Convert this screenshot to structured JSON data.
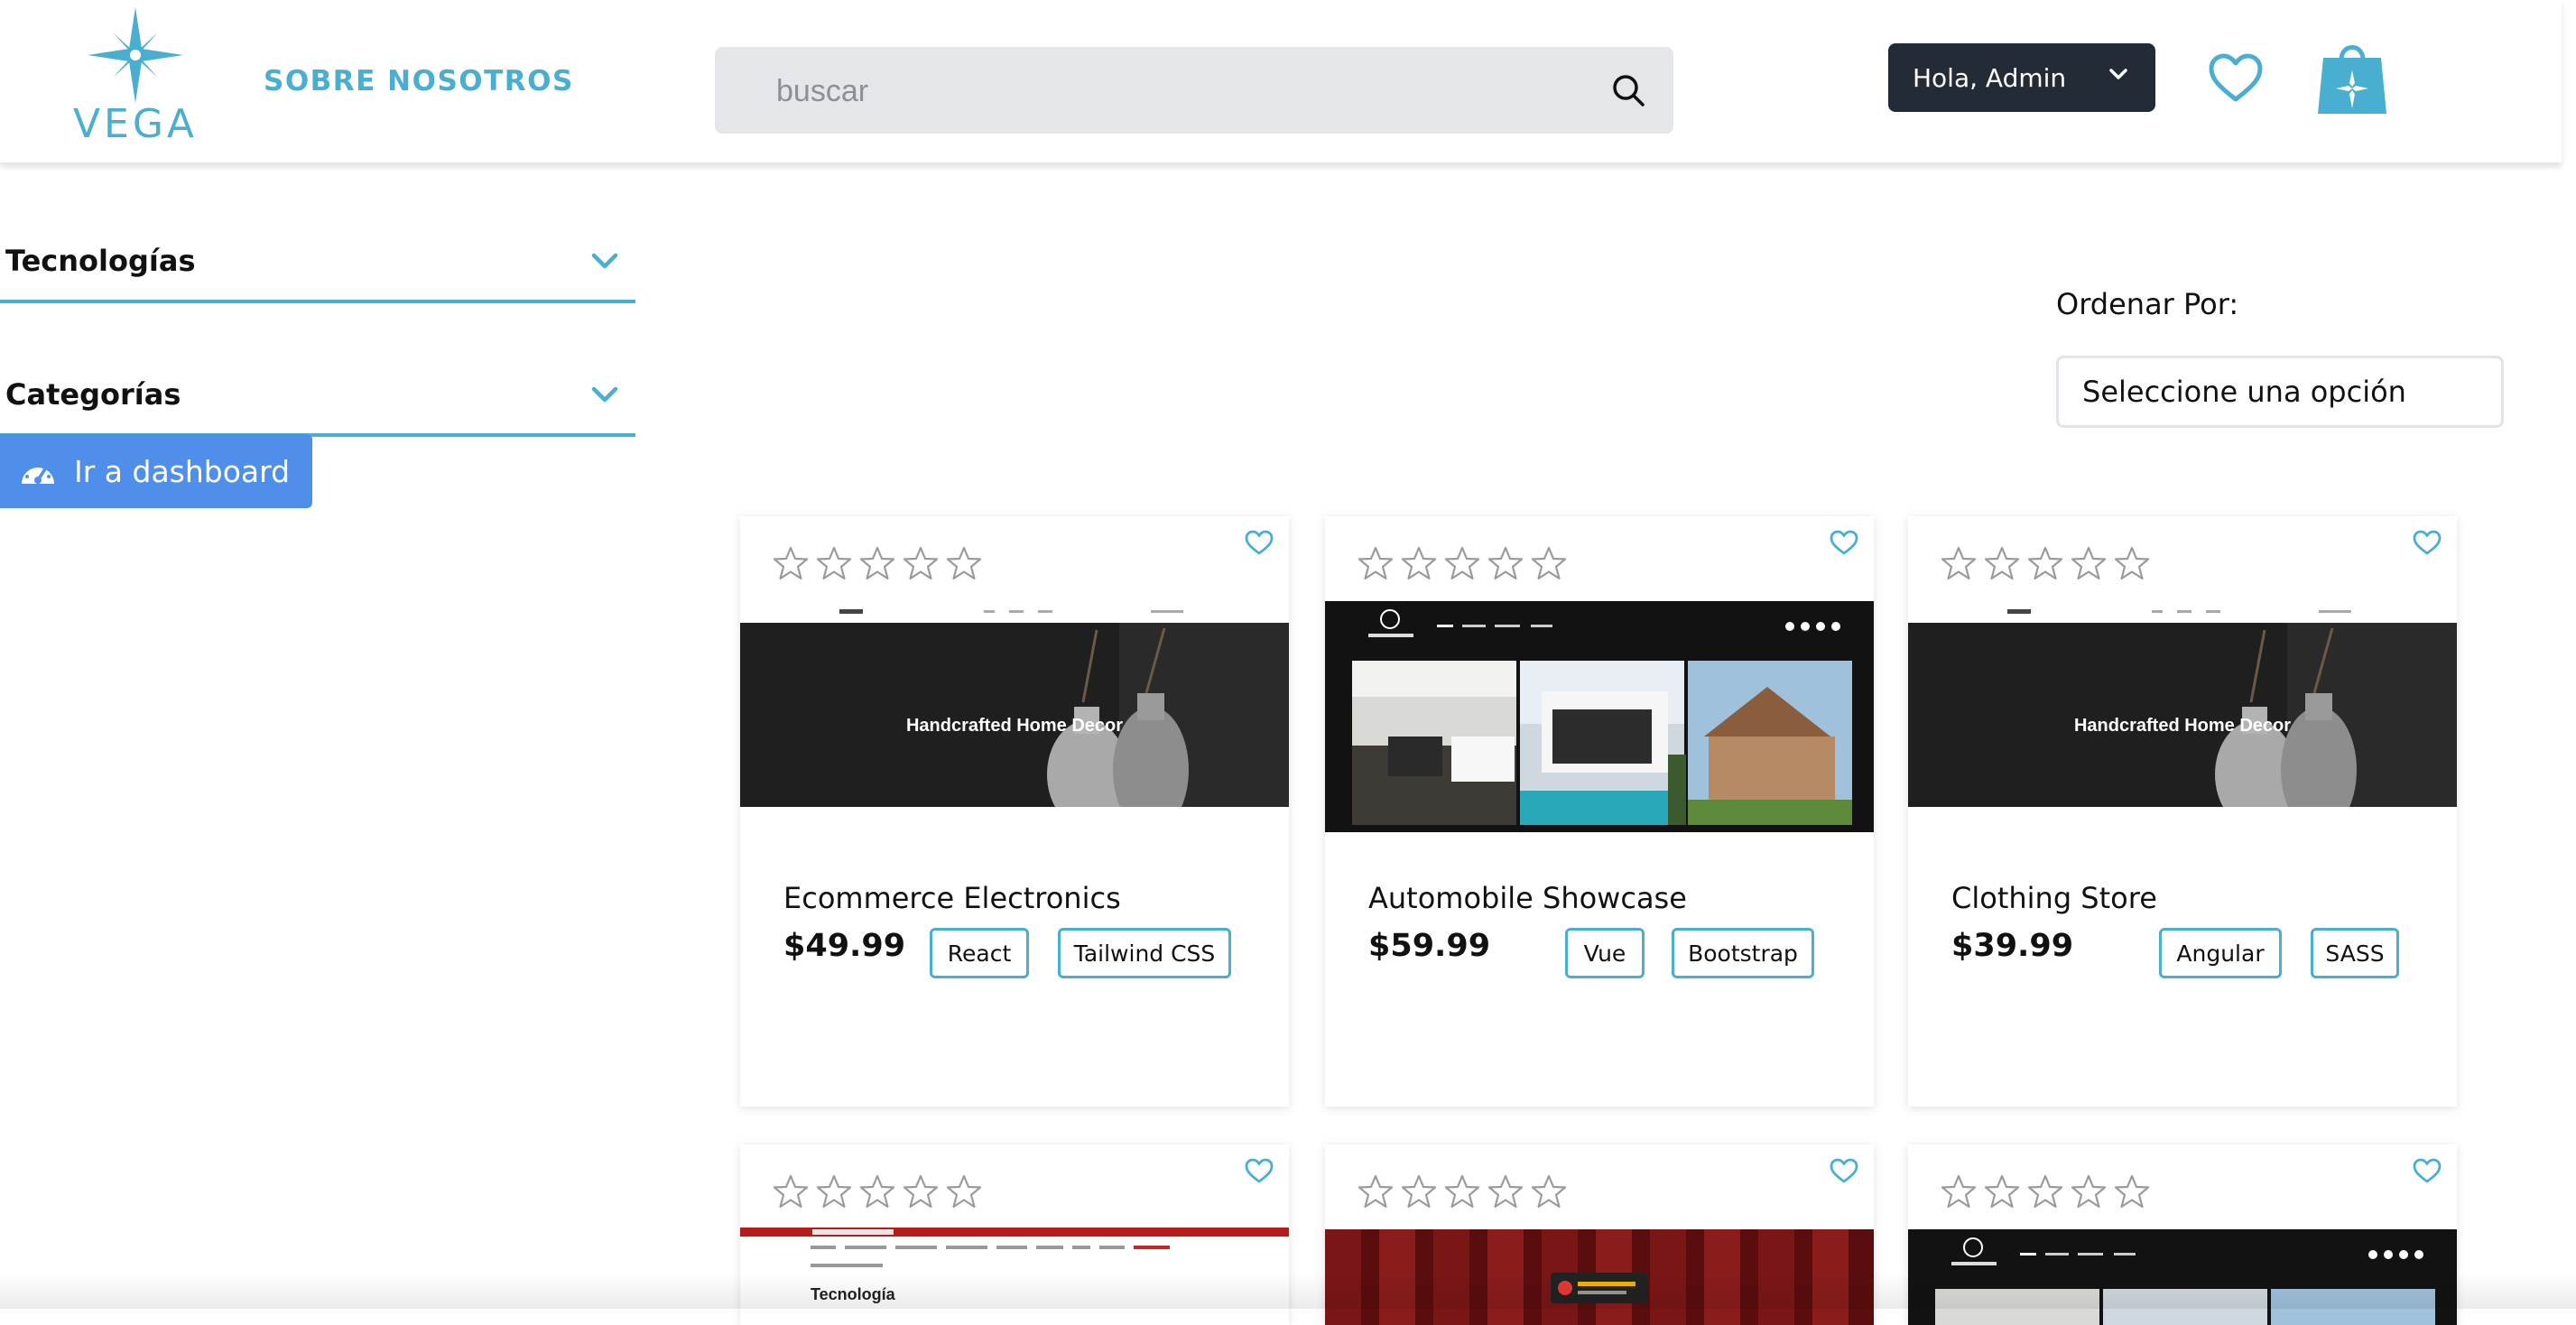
{
  "header": {
    "logo_text": "VEGA",
    "about_label": "SOBRE NOSOTROS",
    "search_placeholder": "buscar",
    "user_label": "Hola, Admin"
  },
  "sidebar": {
    "filters": [
      {
        "label": "Tecnologías"
      },
      {
        "label": "Categorías"
      }
    ],
    "dashboard_label": "Ir a dashboard"
  },
  "sort": {
    "label": "Ordenar Por:",
    "selected": "Seleccione una opción"
  },
  "products": [
    {
      "title": "Ecommerce Electronics",
      "price": "$49.99",
      "tags": [
        "React",
        "Tailwind CSS"
      ],
      "rating": 0,
      "thumb_caption": "Handcrafted Home Decor"
    },
    {
      "title": "Automobile Showcase",
      "price": "$59.99",
      "tags": [
        "Vue",
        "Bootstrap"
      ],
      "rating": 0
    },
    {
      "title": "Clothing Store",
      "price": "$39.99",
      "tags": [
        "Angular",
        "SASS"
      ],
      "rating": 0,
      "thumb_caption": "Handcrafted Home Decor"
    },
    {
      "rating": 0,
      "thumb_caption": "Tecnología"
    },
    {
      "rating": 0
    },
    {
      "rating": 0
    }
  ],
  "colors": {
    "accent": "#4aaed1",
    "dark_button": "#222b36",
    "dashboard_button": "#4f8fe9",
    "search_bg": "#e4e6e9"
  }
}
